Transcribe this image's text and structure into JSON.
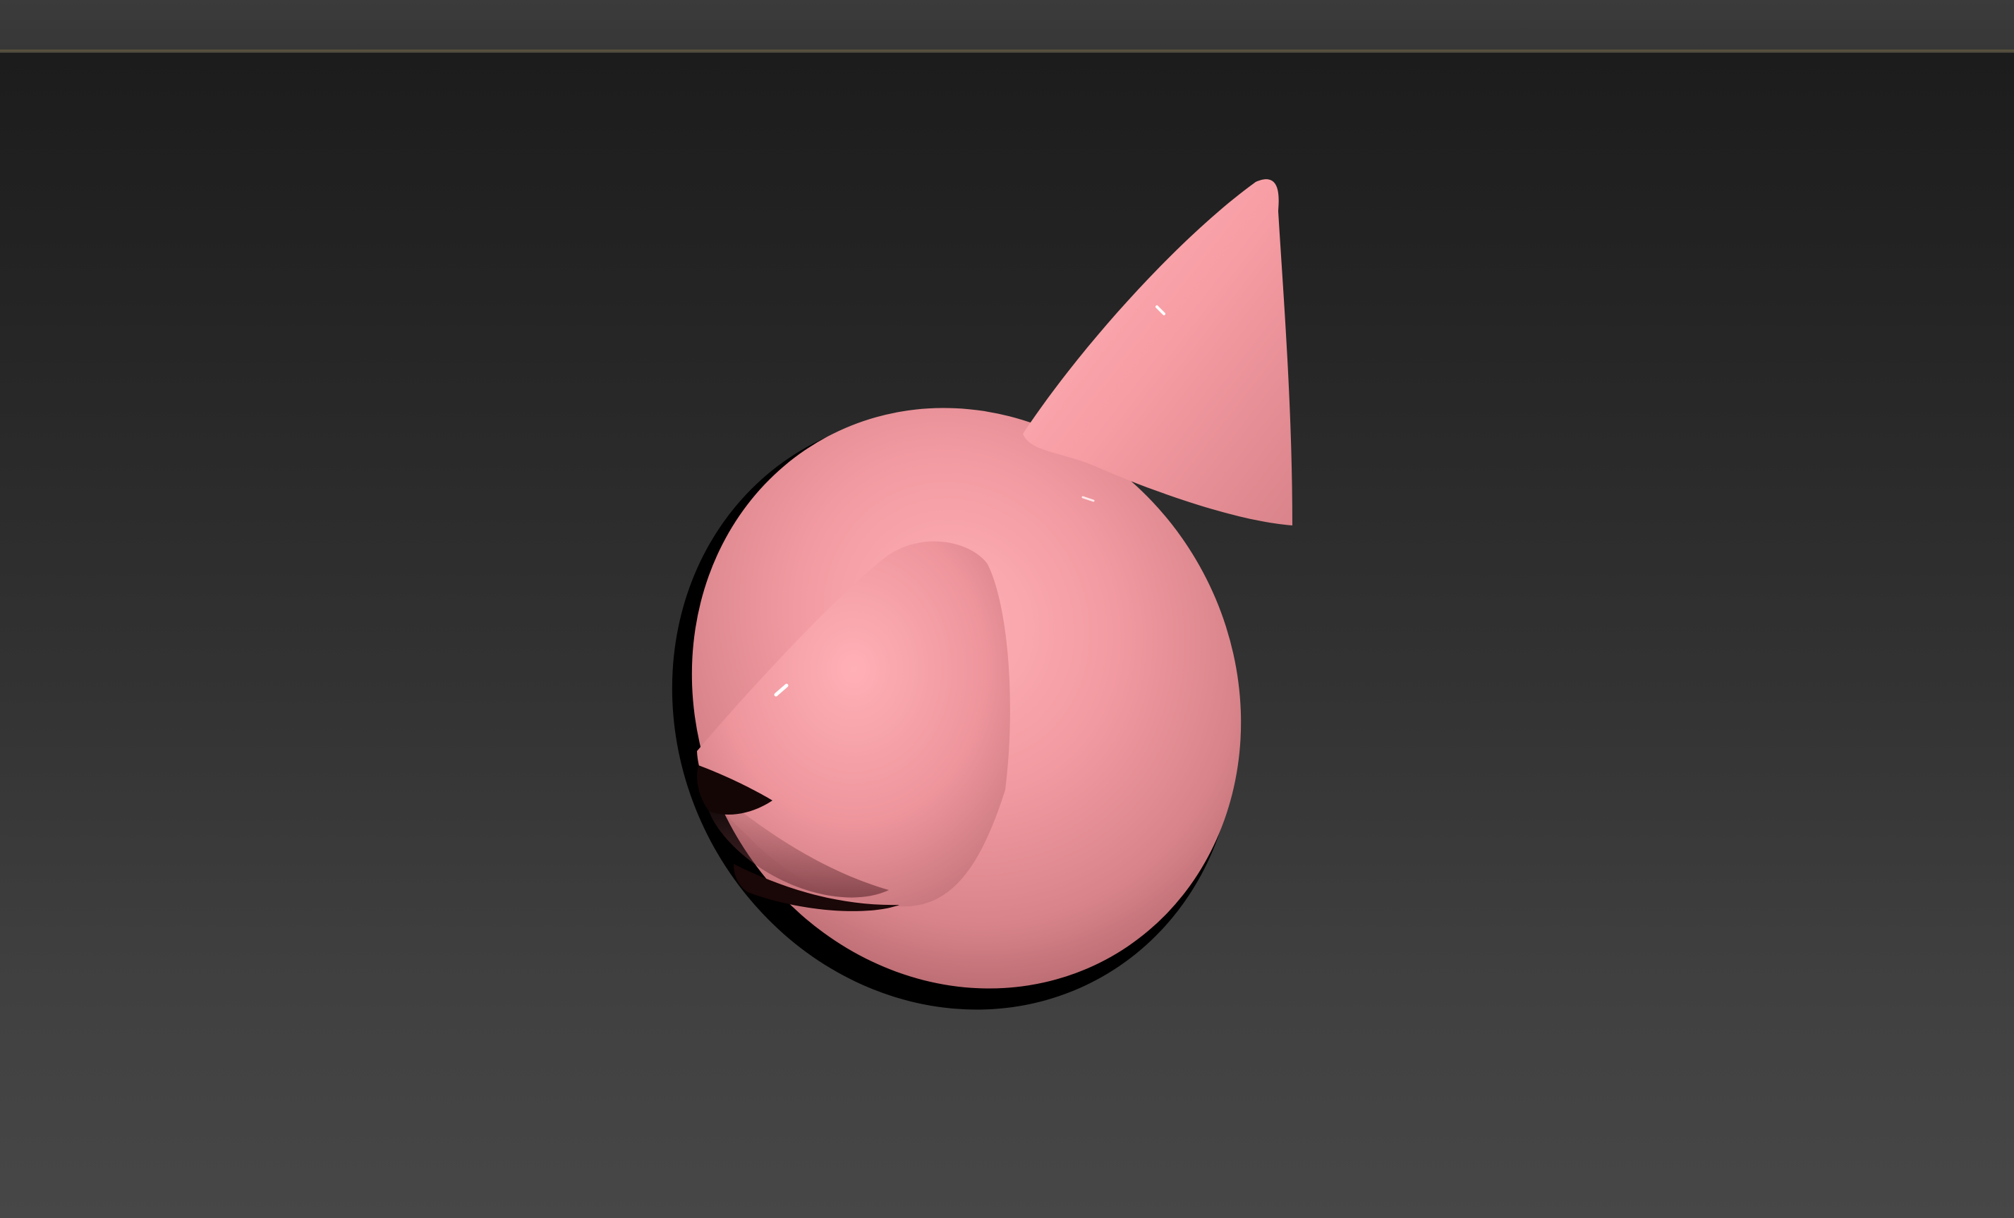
{
  "window": {
    "title": ""
  },
  "viewport": {
    "label": "",
    "background_top": "#1c1c1c",
    "background_bottom": "#474747",
    "border_accent": "#5e5640"
  },
  "scene": {
    "object": "pink-cat-head-model",
    "material_color": "#f0949a",
    "shadow_color": "#000000"
  }
}
